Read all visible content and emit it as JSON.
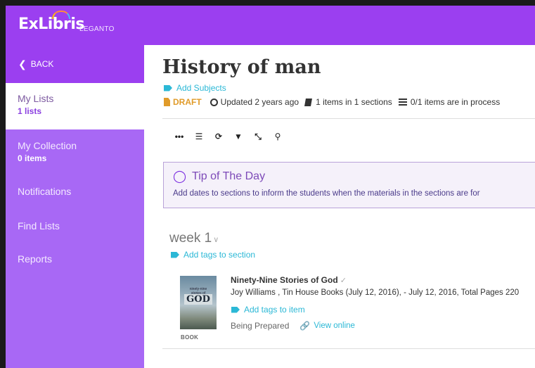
{
  "brand": {
    "logo": "ExLibris",
    "product": "LEGANTO",
    "accent": "#9b3ff0"
  },
  "sidebar": {
    "back_label": "BACK",
    "items": [
      {
        "label": "My Lists",
        "sub": "1 lists",
        "active": true
      },
      {
        "label": "My Collection",
        "sub": "0 items"
      },
      {
        "label": "Notifications"
      },
      {
        "label": "Find Lists"
      },
      {
        "label": "Reports"
      }
    ]
  },
  "list": {
    "title": "History of man",
    "add_subjects": "Add Subjects",
    "status": "DRAFT",
    "updated": "Updated 2 years ago",
    "items_summary": "1 items in 1 sections",
    "process_summary": "0/1 items are in process"
  },
  "toolbar": [
    {
      "icon": "more-icon",
      "glyph": "•••"
    },
    {
      "icon": "list-view-icon",
      "glyph": "☰"
    },
    {
      "icon": "refresh-icon",
      "glyph": "⟳"
    },
    {
      "icon": "filter-icon",
      "glyph": "▼"
    },
    {
      "icon": "collapse-icon",
      "glyph": "⤡"
    },
    {
      "icon": "search-icon",
      "glyph": "⚲"
    }
  ],
  "tip": {
    "title": "Tip of The Day",
    "text": "Add dates to sections to inform the students when the materials in the sections are for"
  },
  "section": {
    "name": "week 1",
    "add_tags": "Add tags to section",
    "items": [
      {
        "title": "Ninety-Nine Stories of God",
        "description": "Joy Williams , Tin House Books (July 12, 2016), - July 12, 2016, Total Pages 220",
        "add_tags": "Add tags to item",
        "reading_status": "Being Prepared",
        "view_online": "View online",
        "type": "BOOK",
        "cover_text": "ninety-nine stories of",
        "cover_big": "GOD"
      }
    ]
  }
}
